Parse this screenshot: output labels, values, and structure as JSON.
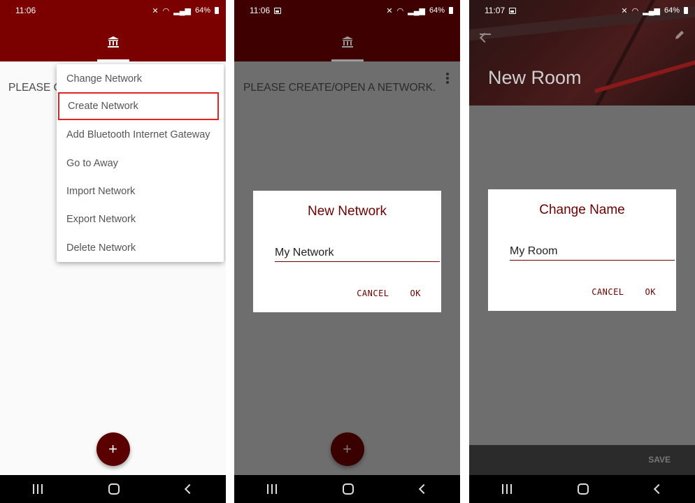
{
  "panels": [
    {
      "status": {
        "time": "11:06",
        "right": "64%"
      },
      "content_text": "PLEASE CREATE/OPEN A NETWORK.",
      "menu": {
        "items": [
          {
            "label": "Change Network"
          },
          {
            "label": "Create Network"
          },
          {
            "label": "Add Bluetooth Internet Gateway"
          },
          {
            "label": "Go to Away"
          },
          {
            "label": "Import Network"
          },
          {
            "label": "Export Network"
          },
          {
            "label": "Delete Network"
          }
        ]
      },
      "fab": "+"
    },
    {
      "status": {
        "time": "11:06",
        "right": "64%"
      },
      "content_text": "PLEASE CREATE/OPEN A NETWORK.",
      "dialog": {
        "title": "New Network",
        "value": "My Network",
        "cancel": "CANCEL",
        "ok": "OK"
      },
      "fab": "+"
    },
    {
      "status": {
        "time": "11:07",
        "right": "64%"
      },
      "header_title": "New Room",
      "dialog": {
        "title": "Change Name",
        "value": "My Room",
        "cancel": "CANCEL",
        "ok": "OK"
      },
      "save": "SAVE"
    }
  ],
  "colors": {
    "primary": "#7b0000",
    "accent": "#6b0000",
    "highlight": "#e52222"
  }
}
